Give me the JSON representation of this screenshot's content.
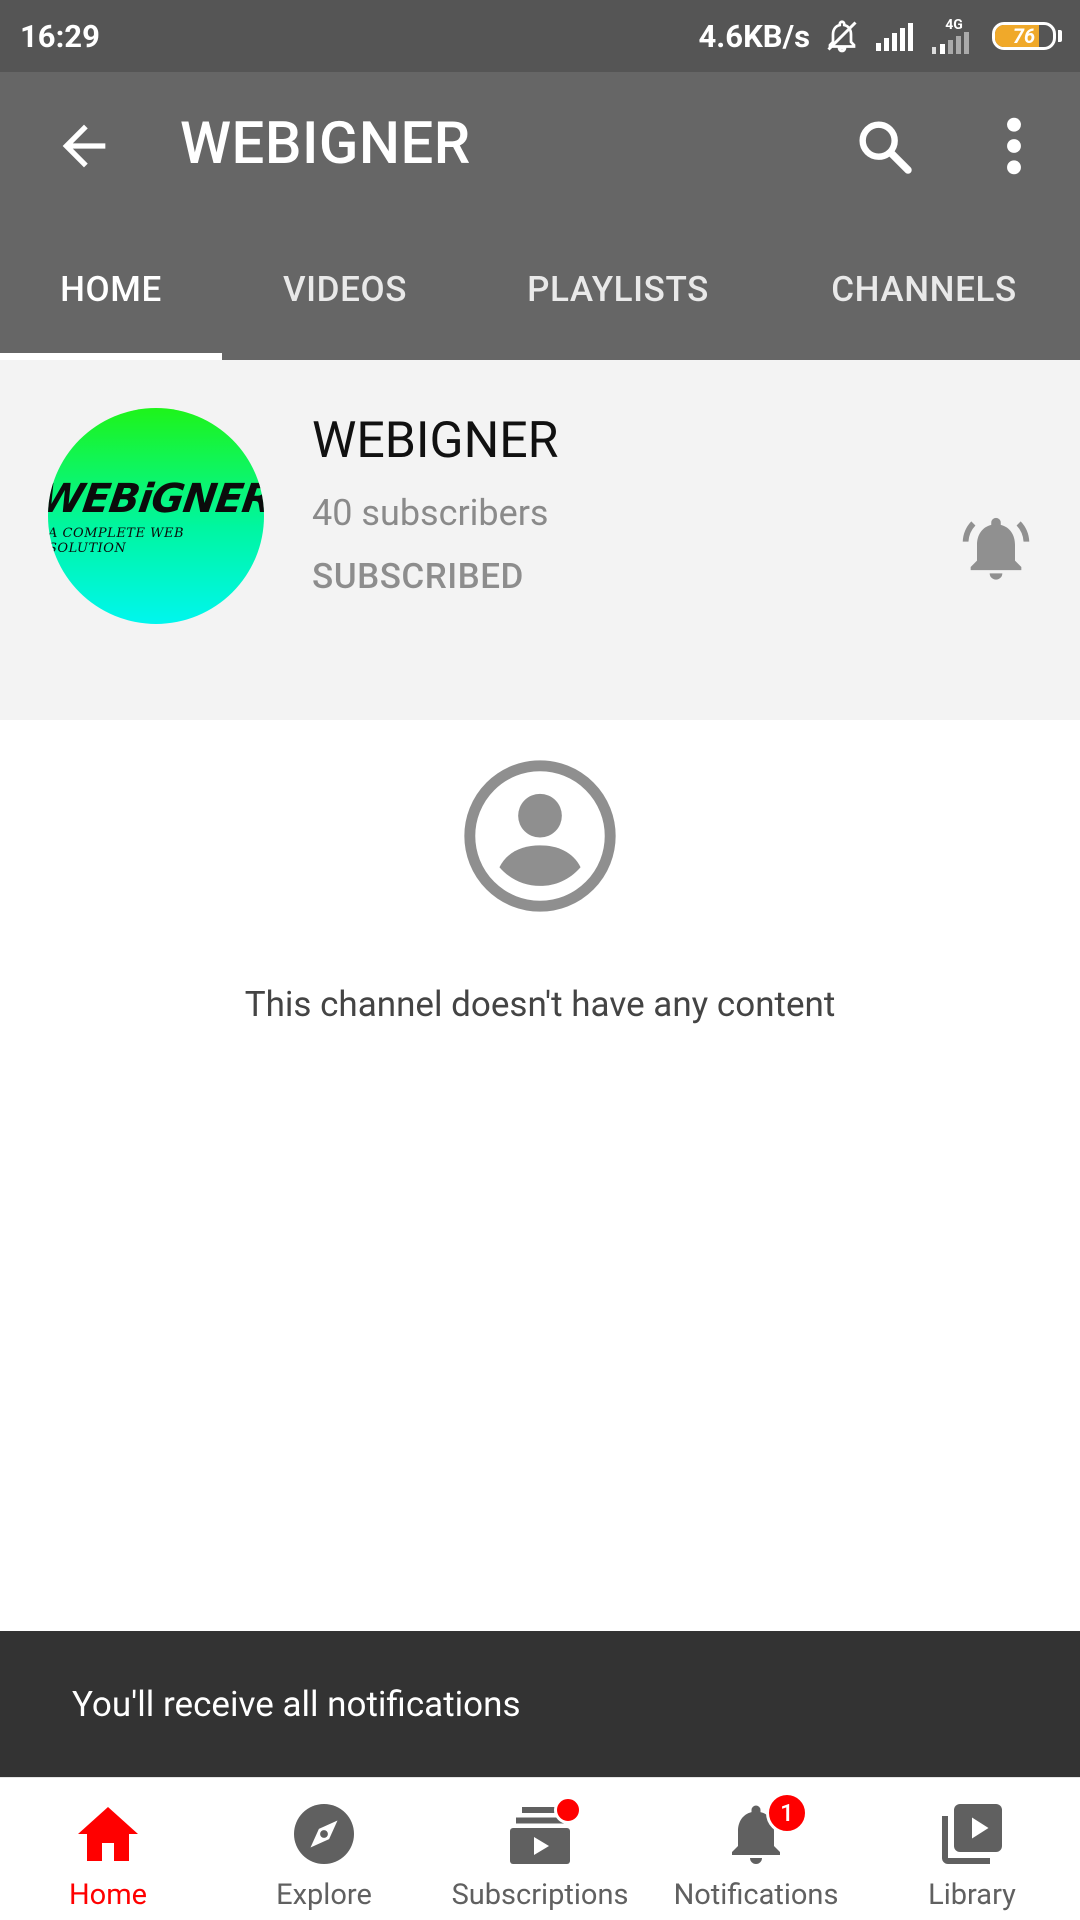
{
  "status_bar": {
    "time": "16:29",
    "net_speed": "4.6KB/s",
    "network_type": "4G",
    "battery": "76",
    "battery_level": 0.76
  },
  "app_bar": {
    "title": "WEBIGNER",
    "icons": [
      "back-arrow-icon",
      "search-icon",
      "more-vert-icon"
    ]
  },
  "tabs": [
    {
      "label": "HOME",
      "active": true
    },
    {
      "label": "VIDEOS",
      "active": false
    },
    {
      "label": "PLAYLISTS",
      "active": false
    },
    {
      "label": "CHANNELS",
      "active": false
    }
  ],
  "channel": {
    "name": "WEBIGNER",
    "subscribers": "40 subscribers",
    "subscribe_state": "SUBSCRIBED",
    "avatar_logo_main": "WEBiGNER",
    "avatar_logo_sub": "A COMPLETE WEB SOLUTION"
  },
  "empty_state": {
    "message": "This channel doesn't have any content"
  },
  "snackbar": {
    "message": "You'll receive all notifications"
  },
  "bottom_nav": [
    {
      "label": "Home",
      "active": true
    },
    {
      "label": "Explore",
      "active": false
    },
    {
      "label": "Subscriptions",
      "active": false
    },
    {
      "label": "Notifications",
      "active": false,
      "badge": "1"
    },
    {
      "label": "Library",
      "active": false
    }
  ],
  "colors": {
    "accent": "#ff0000",
    "app_bar": "#666666",
    "status_bar": "#555555",
    "snackbar": "#333333"
  }
}
